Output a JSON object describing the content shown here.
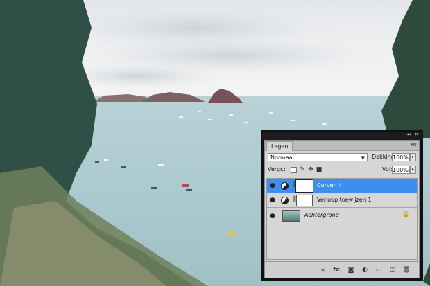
{
  "panel": {
    "tab_label": "Lagen",
    "blend_mode": "Normaal",
    "opacity_label": "Dekking:",
    "opacity_value": "100%",
    "lock_label": "Vergr.:",
    "fill_label": "Vul:",
    "fill_value": "100%",
    "layers": [
      {
        "name": "Curven 4",
        "selected": true
      },
      {
        "name": "Verloop toewijzen 1",
        "selected": false
      },
      {
        "name": "Achtergrond",
        "selected": false
      }
    ],
    "bottom_icons": [
      "link-icon",
      "fx-icon",
      "add-mask-icon",
      "adjustment-layer-icon",
      "new-group-icon",
      "new-layer-icon",
      "delete-layer-icon"
    ],
    "bottom_fx_text": "fx."
  },
  "colors": {
    "selection": "#3c8ef0",
    "panel_bg": "#d6d6d6",
    "panel_frame": "#111111"
  }
}
